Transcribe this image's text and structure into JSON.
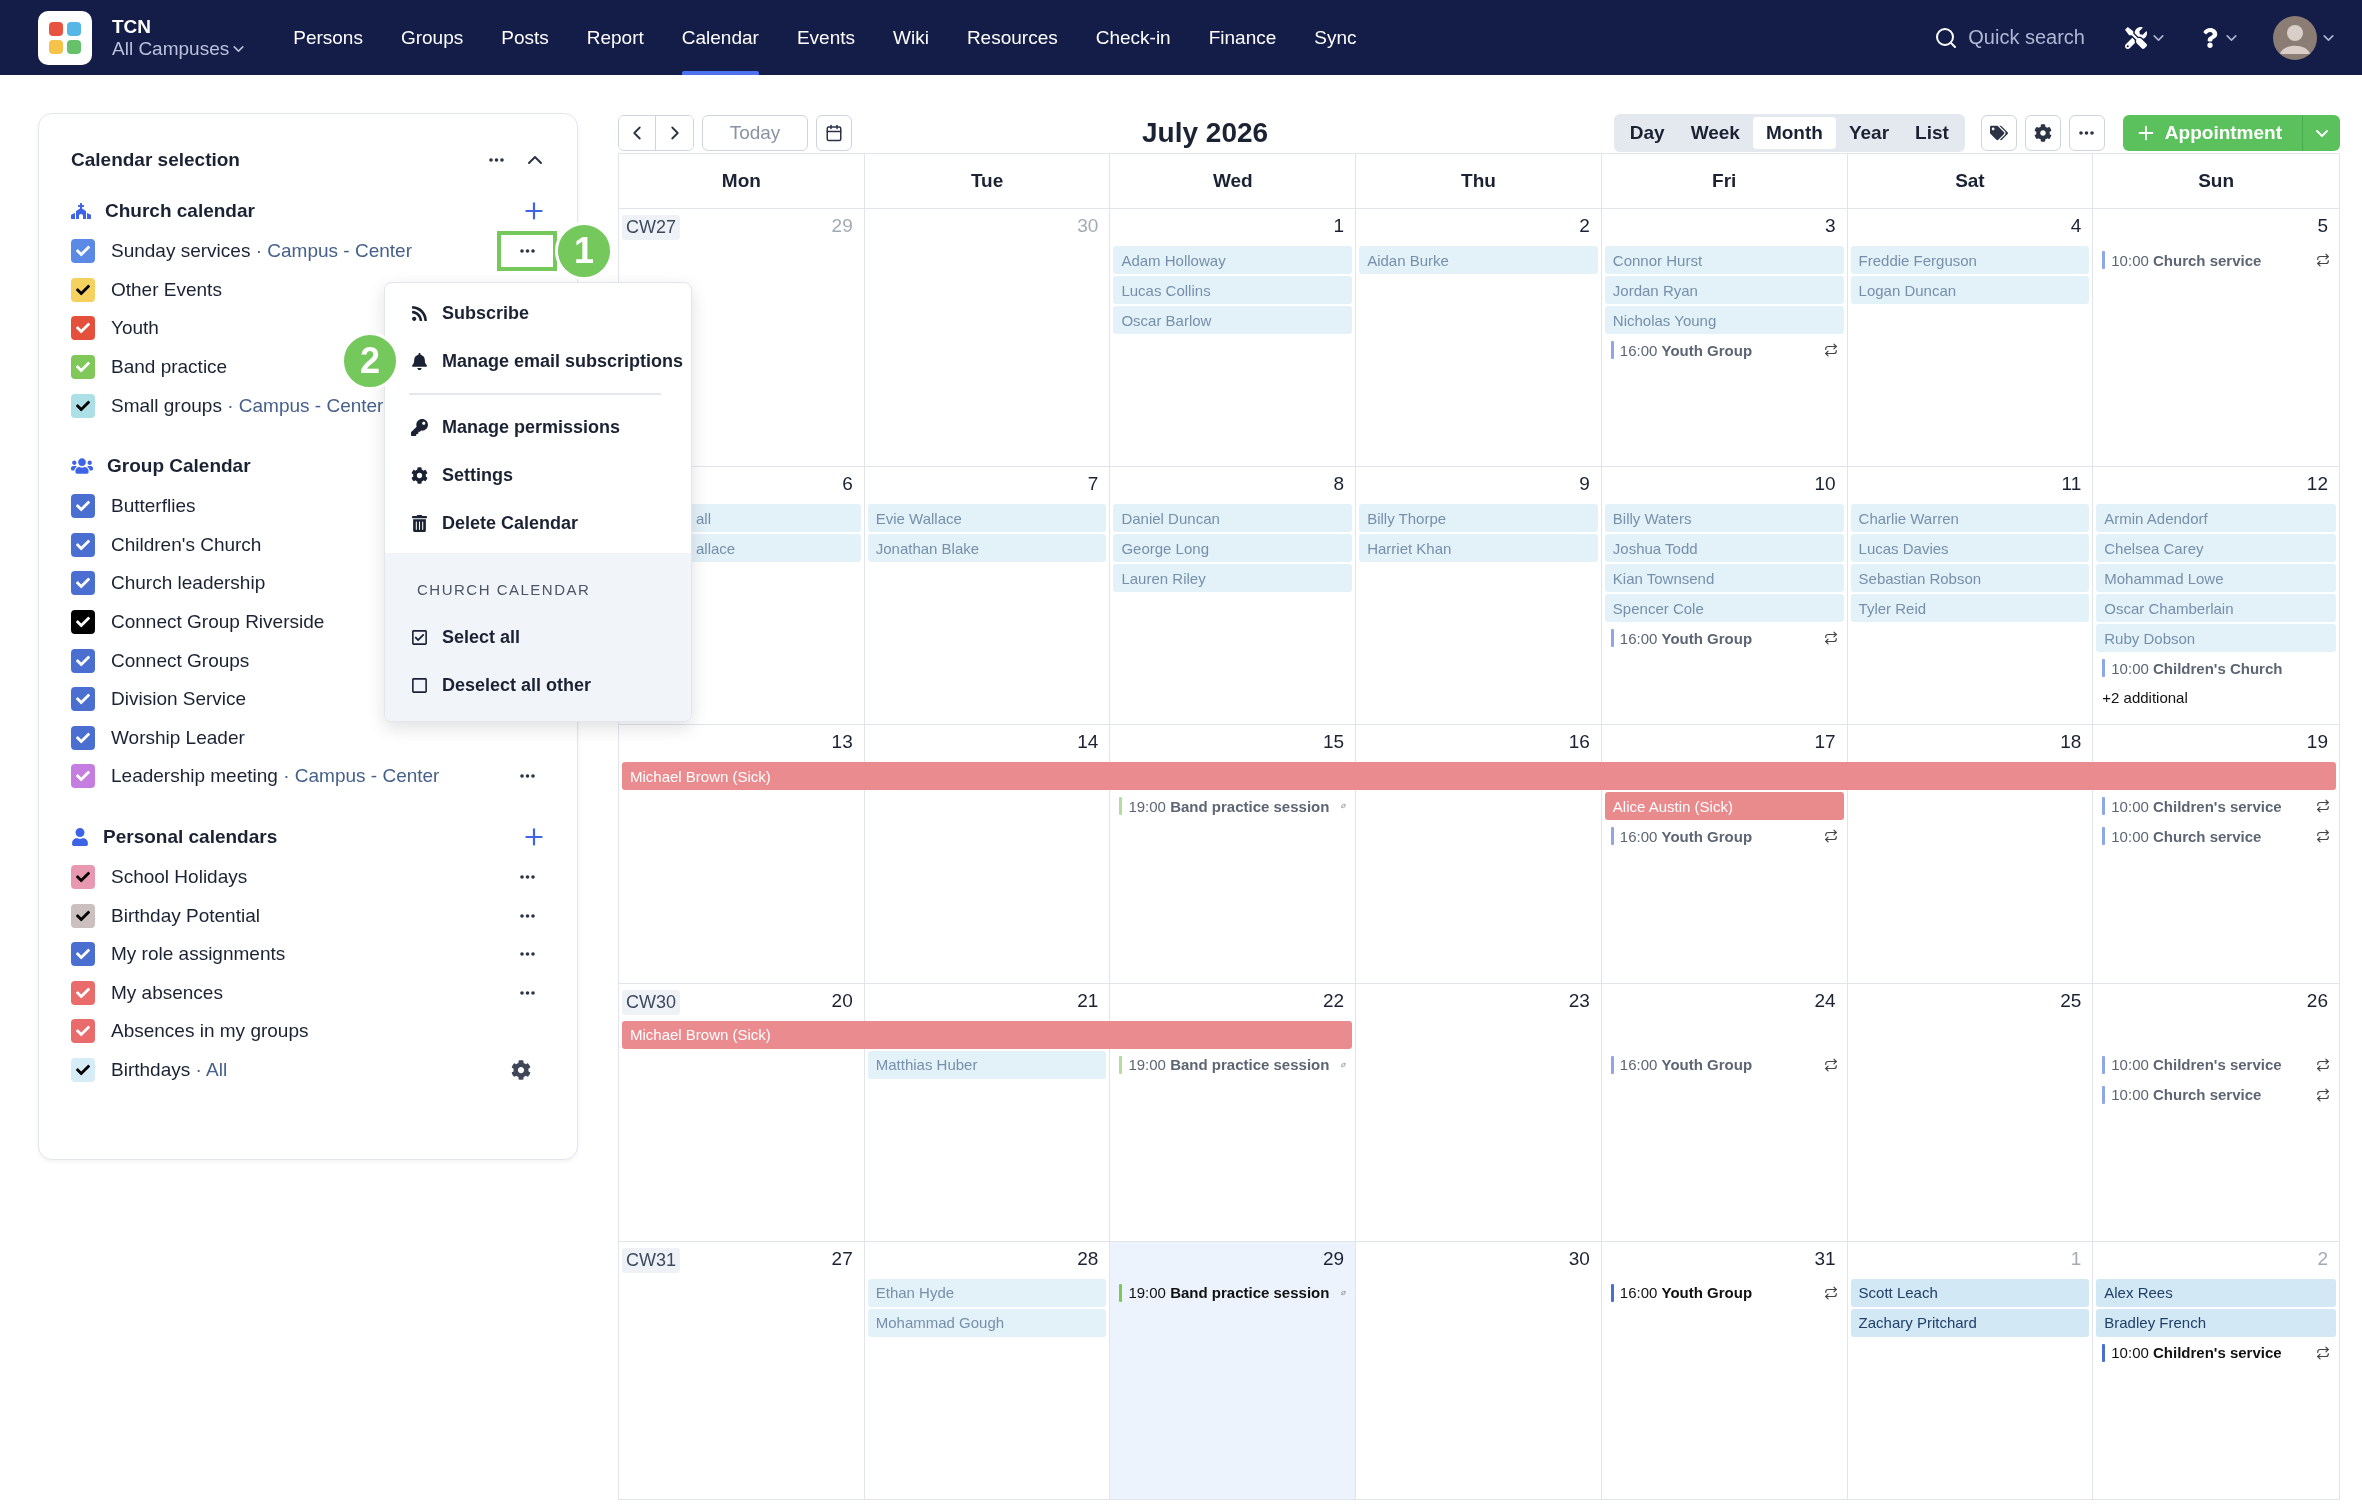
{
  "nav": {
    "brand": "TCN",
    "campus": "All Campuses",
    "search": {
      "placeholder": "Quick search"
    },
    "items": [
      {
        "label": "Persons",
        "selected": false
      },
      {
        "label": "Groups",
        "selected": false
      },
      {
        "label": "Posts",
        "selected": false
      },
      {
        "label": "Report",
        "selected": false
      },
      {
        "label": "Calendar",
        "selected": true
      },
      {
        "label": "Events",
        "selected": false
      },
      {
        "label": "Wiki",
        "selected": false
      },
      {
        "label": "Resources",
        "selected": false
      },
      {
        "label": "Check-in",
        "selected": false
      },
      {
        "label": "Finance",
        "selected": false
      },
      {
        "label": "Sync",
        "selected": false
      }
    ]
  },
  "sidebar": {
    "title": "Calendar selection",
    "sections": [
      {
        "title": "Church calendar",
        "kind": "church",
        "add": true,
        "items": [
          {
            "label": "Sunday services",
            "sub": "· Campus - Center",
            "color": "#5b8ae6",
            "checked": true,
            "more": true,
            "settings": false,
            "callout": "1"
          },
          {
            "label": "Other Events",
            "color": "#f5d160",
            "checked": true,
            "more": false,
            "settings": false
          },
          {
            "label": "Youth",
            "color": "#e5503c",
            "checked": true,
            "more": false,
            "settings": false
          },
          {
            "label": "Band practice",
            "color": "#80c85a",
            "checked": true,
            "more": false,
            "settings": false
          },
          {
            "label": "Small groups",
            "sub": "· Campus - Center",
            "color": "#acdfe6",
            "checked": true,
            "more": false,
            "settings": false
          }
        ]
      },
      {
        "title": "Group Calendar",
        "kind": "group",
        "add": false,
        "items": [
          {
            "label": "Butterflies",
            "color": "#4a6fd0",
            "checked": true,
            "more": false,
            "settings": false
          },
          {
            "label": "Children's Church",
            "color": "#4a6fd0",
            "checked": true,
            "more": false,
            "settings": false
          },
          {
            "label": "Church leadership",
            "color": "#4a6fd0",
            "checked": true,
            "more": false,
            "settings": false
          },
          {
            "label": "Connect Group Riverside",
            "color": "#000000",
            "checked": true,
            "more": false,
            "settings": false
          },
          {
            "label": "Connect Groups",
            "color": "#4a6fd0",
            "checked": true,
            "more": false,
            "settings": false
          },
          {
            "label": "Division Service",
            "color": "#4a6fd0",
            "checked": true,
            "more": false,
            "settings": false
          },
          {
            "label": "Worship Leader",
            "color": "#4a6fd0",
            "checked": true,
            "more": false,
            "settings": false
          },
          {
            "label": "Leadership meeting",
            "sub": "· Campus - Center",
            "color": "#c57ee0",
            "checked": true,
            "more": true,
            "settings": false
          }
        ]
      },
      {
        "title": "Personal calendars",
        "kind": "person",
        "add": true,
        "items": [
          {
            "label": "School Holidays",
            "color": "#e898b0",
            "checked": true,
            "more": true,
            "settings": false
          },
          {
            "label": "Birthday Potential",
            "color": "#cbbfbf",
            "checked": true,
            "more": true,
            "settings": false
          },
          {
            "label": "My role assignments",
            "color": "#4a6fd0",
            "checked": true,
            "more": true,
            "settings": false
          },
          {
            "label": "My absences",
            "color": "#e96b6b",
            "checked": true,
            "more": true,
            "settings": false
          },
          {
            "label": "Absences in my groups",
            "color": "#e96b6b",
            "checked": true,
            "more": false,
            "settings": false
          },
          {
            "label": "Birthdays",
            "sub": "· All",
            "color": "#d6ecf7",
            "checked": true,
            "more": false,
            "settings": true
          }
        ]
      }
    ]
  },
  "menu": {
    "groups": [
      [
        {
          "kind": "rss",
          "label": "Subscribe"
        },
        {
          "kind": "bell",
          "label": "Manage email subscriptions",
          "callout": "2"
        }
      ],
      [
        {
          "kind": "key",
          "label": "Manage permissions"
        },
        {
          "kind": "gear",
          "label": "Settings"
        },
        {
          "kind": "trash",
          "label": "Delete Calendar"
        }
      ]
    ],
    "footer": {
      "title": "CHURCH CALENDAR",
      "items": [
        {
          "kind": "checked",
          "label": "Select all"
        },
        {
          "kind": "unchecked",
          "label": "Deselect all other"
        }
      ]
    }
  },
  "toolbar": {
    "today": {
      "label": "Today",
      "disabled": true
    },
    "title": "July 2026",
    "views": [
      {
        "label": "Day",
        "selected": false
      },
      {
        "label": "Week",
        "selected": false
      },
      {
        "label": "Month",
        "selected": true
      },
      {
        "label": "Year",
        "selected": false
      },
      {
        "label": "List",
        "selected": false
      }
    ],
    "appointment": "Appointment"
  },
  "calendar": {
    "weekdays": [
      "Mon",
      "Tue",
      "Wed",
      "Thu",
      "Fri",
      "Sat",
      "Sun"
    ],
    "weeks": [
      {
        "cw": "CW27",
        "days": [
          {
            "date": "29",
            "outside": true,
            "today": false,
            "absence_bar": false
          },
          {
            "date": "30",
            "outside": true,
            "today": false,
            "absence_bar": false
          },
          {
            "date": "1",
            "outside": false,
            "past": true,
            "today": false,
            "absence_bar": false,
            "items": [
              {
                "kind": "name",
                "label": "Adam Holloway"
              },
              {
                "kind": "name",
                "label": "Lucas Collins"
              },
              {
                "kind": "name",
                "label": "Oscar Barlow"
              }
            ]
          },
          {
            "date": "2",
            "outside": false,
            "past": true,
            "today": false,
            "absence_bar": false,
            "items": [
              {
                "kind": "name",
                "label": "Aidan Burke"
              }
            ]
          },
          {
            "date": "3",
            "outside": false,
            "past": true,
            "today": false,
            "absence_bar": false,
            "items": [
              {
                "kind": "name",
                "label": "Connor Hurst"
              },
              {
                "kind": "name",
                "label": "Jordan Ryan"
              },
              {
                "kind": "name",
                "label": "Nicholas Young"
              },
              {
                "kind": "event",
                "time": "16:00",
                "title": "Youth Group",
                "color": "#8fa7e6",
                "recurring": true
              }
            ]
          },
          {
            "date": "4",
            "outside": false,
            "past": true,
            "today": false,
            "absence_bar": false,
            "items": [
              {
                "kind": "name",
                "label": "Freddie Ferguson"
              },
              {
                "kind": "name",
                "label": "Logan Duncan"
              }
            ]
          },
          {
            "date": "5",
            "outside": false,
            "past": true,
            "today": false,
            "absence_bar": false,
            "items": [
              {
                "kind": "event",
                "time": "10:00",
                "title": "Church service",
                "color": "#8fa7e6",
                "recurring": true
              }
            ]
          }
        ]
      },
      {
        "days": [
          {
            "date": "6",
            "outside": false,
            "past": true,
            "today": false,
            "absence_bar": false,
            "items": [
              {
                "kind": "clipped",
                "label": "all"
              },
              {
                "kind": "clipped",
                "label": "allace"
              }
            ]
          },
          {
            "date": "7",
            "outside": false,
            "past": true,
            "today": false,
            "absence_bar": false,
            "items": [
              {
                "kind": "name",
                "label": "Evie Wallace"
              },
              {
                "kind": "name",
                "label": "Jonathan Blake"
              }
            ]
          },
          {
            "date": "8",
            "outside": false,
            "past": true,
            "today": false,
            "absence_bar": false,
            "items": [
              {
                "kind": "name",
                "label": "Daniel Duncan"
              },
              {
                "kind": "name",
                "label": "George Long"
              },
              {
                "kind": "name",
                "label": "Lauren Riley"
              }
            ]
          },
          {
            "date": "9",
            "outside": false,
            "past": true,
            "today": false,
            "absence_bar": false,
            "items": [
              {
                "kind": "name",
                "label": "Billy Thorpe"
              },
              {
                "kind": "name",
                "label": "Harriet Khan"
              }
            ]
          },
          {
            "date": "10",
            "outside": false,
            "past": true,
            "today": false,
            "absence_bar": false,
            "items": [
              {
                "kind": "name",
                "label": "Billy Waters"
              },
              {
                "kind": "name",
                "label": "Joshua Todd"
              },
              {
                "kind": "name",
                "label": "Kian Townsend"
              },
              {
                "kind": "name",
                "label": "Spencer Cole"
              },
              {
                "kind": "event",
                "time": "16:00",
                "title": "Youth Group",
                "color": "#8fa7e6",
                "recurring": true
              }
            ]
          },
          {
            "date": "11",
            "outside": false,
            "past": true,
            "today": false,
            "absence_bar": false,
            "items": [
              {
                "kind": "name",
                "label": "Charlie Warren"
              },
              {
                "kind": "name",
                "label": "Lucas Davies"
              },
              {
                "kind": "name",
                "label": "Sebastian Robson"
              },
              {
                "kind": "name",
                "label": "Tyler Reid"
              }
            ]
          },
          {
            "date": "12",
            "outside": false,
            "past": true,
            "today": false,
            "absence_bar": false,
            "items": [
              {
                "kind": "name",
                "label": "Armin Adendorf"
              },
              {
                "kind": "name",
                "label": "Chelsea Carey"
              },
              {
                "kind": "name",
                "label": "Mohammad Lowe"
              },
              {
                "kind": "name",
                "label": "Oscar Chamberlain"
              },
              {
                "kind": "name",
                "label": "Ruby Dobson"
              },
              {
                "kind": "event",
                "time": "10:00",
                "title": "Children's Church",
                "color": "#8fa7e6",
                "recurring": false
              },
              {
                "kind": "more",
                "label": "+2 additional"
              }
            ]
          }
        ]
      },
      {
        "bar_label": "Michael Brown (Sick)",
        "days": [
          {
            "date": "13",
            "outside": false,
            "today": false,
            "absence_bar": true
          },
          {
            "date": "14",
            "outside": false,
            "today": false,
            "absence_bar": true
          },
          {
            "date": "15",
            "outside": false,
            "past": true,
            "today": false,
            "absence_bar": true,
            "items": [
              {
                "kind": "event",
                "time": "19:00",
                "title": "Band practice session",
                "color": "#b3dd9b",
                "recurring": true
              }
            ]
          },
          {
            "date": "16",
            "outside": false,
            "today": false,
            "absence_bar": true
          },
          {
            "date": "17",
            "outside": false,
            "past": true,
            "today": false,
            "absence_bar": true,
            "items": [
              {
                "kind": "absence",
                "label": "Alice Austin (Sick)"
              },
              {
                "kind": "event",
                "time": "16:00",
                "title": "Youth Group",
                "color": "#8fa7e6",
                "recurring": true
              }
            ]
          },
          {
            "date": "18",
            "outside": false,
            "today": false,
            "absence_bar": true
          },
          {
            "date": "19",
            "outside": false,
            "past": true,
            "today": false,
            "absence_bar": true,
            "items": [
              {
                "kind": "event",
                "time": "10:00",
                "title": "Children's service",
                "color": "#8fa7e6",
                "recurring": true
              },
              {
                "kind": "event",
                "time": "10:00",
                "title": "Church service",
                "color": "#8fa7e6",
                "recurring": true
              }
            ]
          }
        ]
      },
      {
        "cw": "CW30",
        "bar_label": "Michael Brown (Sick)",
        "days": [
          {
            "date": "20",
            "outside": false,
            "today": false,
            "absence_bar": true
          },
          {
            "date": "21",
            "outside": false,
            "past": true,
            "today": false,
            "absence_bar": true,
            "items": [
              {
                "kind": "name",
                "label": "Matthias Huber"
              }
            ]
          },
          {
            "date": "22",
            "outside": false,
            "past": true,
            "today": false,
            "absence_bar": true,
            "items": [
              {
                "kind": "event",
                "time": "19:00",
                "title": "Band practice session",
                "color": "#b3dd9b",
                "recurring": true
              }
            ]
          },
          {
            "date": "23",
            "outside": false,
            "today": false,
            "absence_bar": false
          },
          {
            "date": "24",
            "outside": false,
            "past": true,
            "today": false,
            "absence_bar": false,
            "items": [
              {
                "kind": "event",
                "time": "16:00",
                "title": "Youth Group",
                "color": "#8fa7e6",
                "recurring": true
              }
            ]
          },
          {
            "date": "25",
            "outside": false,
            "today": false,
            "absence_bar": false
          },
          {
            "date": "26",
            "outside": false,
            "past": true,
            "today": false,
            "absence_bar": false,
            "items": [
              {
                "kind": "event",
                "time": "10:00",
                "title": "Children's service",
                "color": "#8fa7e6",
                "recurring": true
              },
              {
                "kind": "event",
                "time": "10:00",
                "title": "Church service",
                "color": "#8fa7e6",
                "recurring": true
              }
            ]
          }
        ]
      },
      {
        "cw": "CW31",
        "days": [
          {
            "date": "27",
            "outside": false,
            "today": false,
            "absence_bar": false
          },
          {
            "date": "28",
            "outside": false,
            "past": true,
            "today": false,
            "absence_bar": false,
            "items": [
              {
                "kind": "name",
                "label": "Ethan Hyde"
              },
              {
                "kind": "name",
                "label": "Mohammad Gough"
              }
            ]
          },
          {
            "date": "29",
            "outside": false,
            "past": false,
            "today": true,
            "absence_bar": false,
            "items": [
              {
                "kind": "event",
                "time": "19:00",
                "title": "Band practice session",
                "color": "#7cc857",
                "recurring": true
              }
            ]
          },
          {
            "date": "30",
            "outside": false,
            "today": false,
            "absence_bar": false
          },
          {
            "date": "31",
            "outside": false,
            "past": false,
            "today": false,
            "absence_bar": false,
            "items": [
              {
                "kind": "event",
                "time": "16:00",
                "title": "Youth Group",
                "color": "#4a6fd0",
                "recurring": true
              }
            ]
          },
          {
            "date": "1",
            "outside": true,
            "past": false,
            "today": false,
            "absence_bar": false,
            "items": [
              {
                "kind": "name",
                "label": "Scott Leach"
              },
              {
                "kind": "name",
                "label": "Zachary Pritchard"
              }
            ]
          },
          {
            "date": "2",
            "outside": true,
            "past": false,
            "today": false,
            "absence_bar": false,
            "items": [
              {
                "kind": "name",
                "label": "Alex Rees"
              },
              {
                "kind": "name",
                "label": "Bradley French"
              },
              {
                "kind": "event",
                "time": "10:00",
                "title": "Children's service",
                "color": "#4a6fd0",
                "recurring": true
              }
            ]
          }
        ]
      }
    ]
  }
}
